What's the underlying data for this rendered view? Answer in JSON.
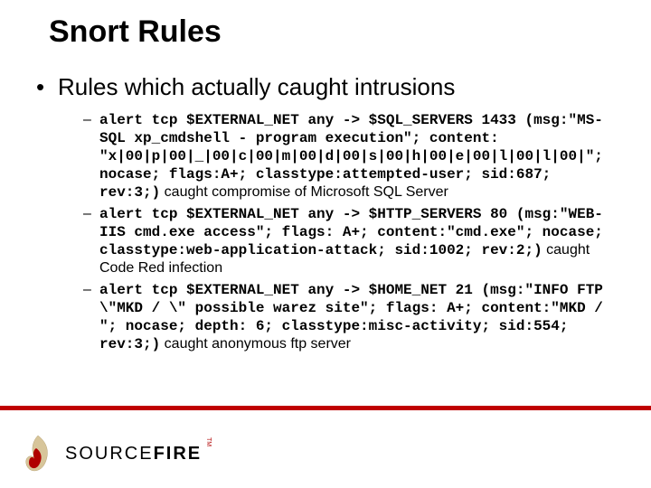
{
  "title": "Snort Rules",
  "main_bullet": "Rules which actually caught intrusions",
  "rules": [
    {
      "code": "alert tcp $EXTERNAL_NET any -> $SQL_SERVERS 1433 (msg:\"MS-SQL xp_cmdshell - program execution\"; content: \"x|00|p|00|_|00|c|00|m|00|d|00|s|00|h|00|e|00|l|00|l|00|\"; nocase; flags:A+; classtype:attempted-user; sid:687; rev:3;)",
      "annotation": "caught compromise of Microsoft SQL Server"
    },
    {
      "code": "alert tcp $EXTERNAL_NET any -> $HTTP_SERVERS 80 (msg:\"WEB-IIS cmd.exe access\"; flags: A+; content:\"cmd.exe\"; nocase; classtype:web-application-attack; sid:1002; rev:2;)",
      "annotation": "caught Code Red infection"
    },
    {
      "code": "alert tcp $EXTERNAL_NET any -> $HOME_NET 21 (msg:\"INFO FTP \\\"MKD / \\\" possible warez site\"; flags: A+; content:\"MKD / \"; nocase; depth: 6; classtype:misc-activity; sid:554; rev:3;)",
      "annotation": "caught anonymous ftp server"
    }
  ],
  "brand": {
    "part1": "SOURCE",
    "part2": "FIRE",
    "tm": "TM"
  }
}
